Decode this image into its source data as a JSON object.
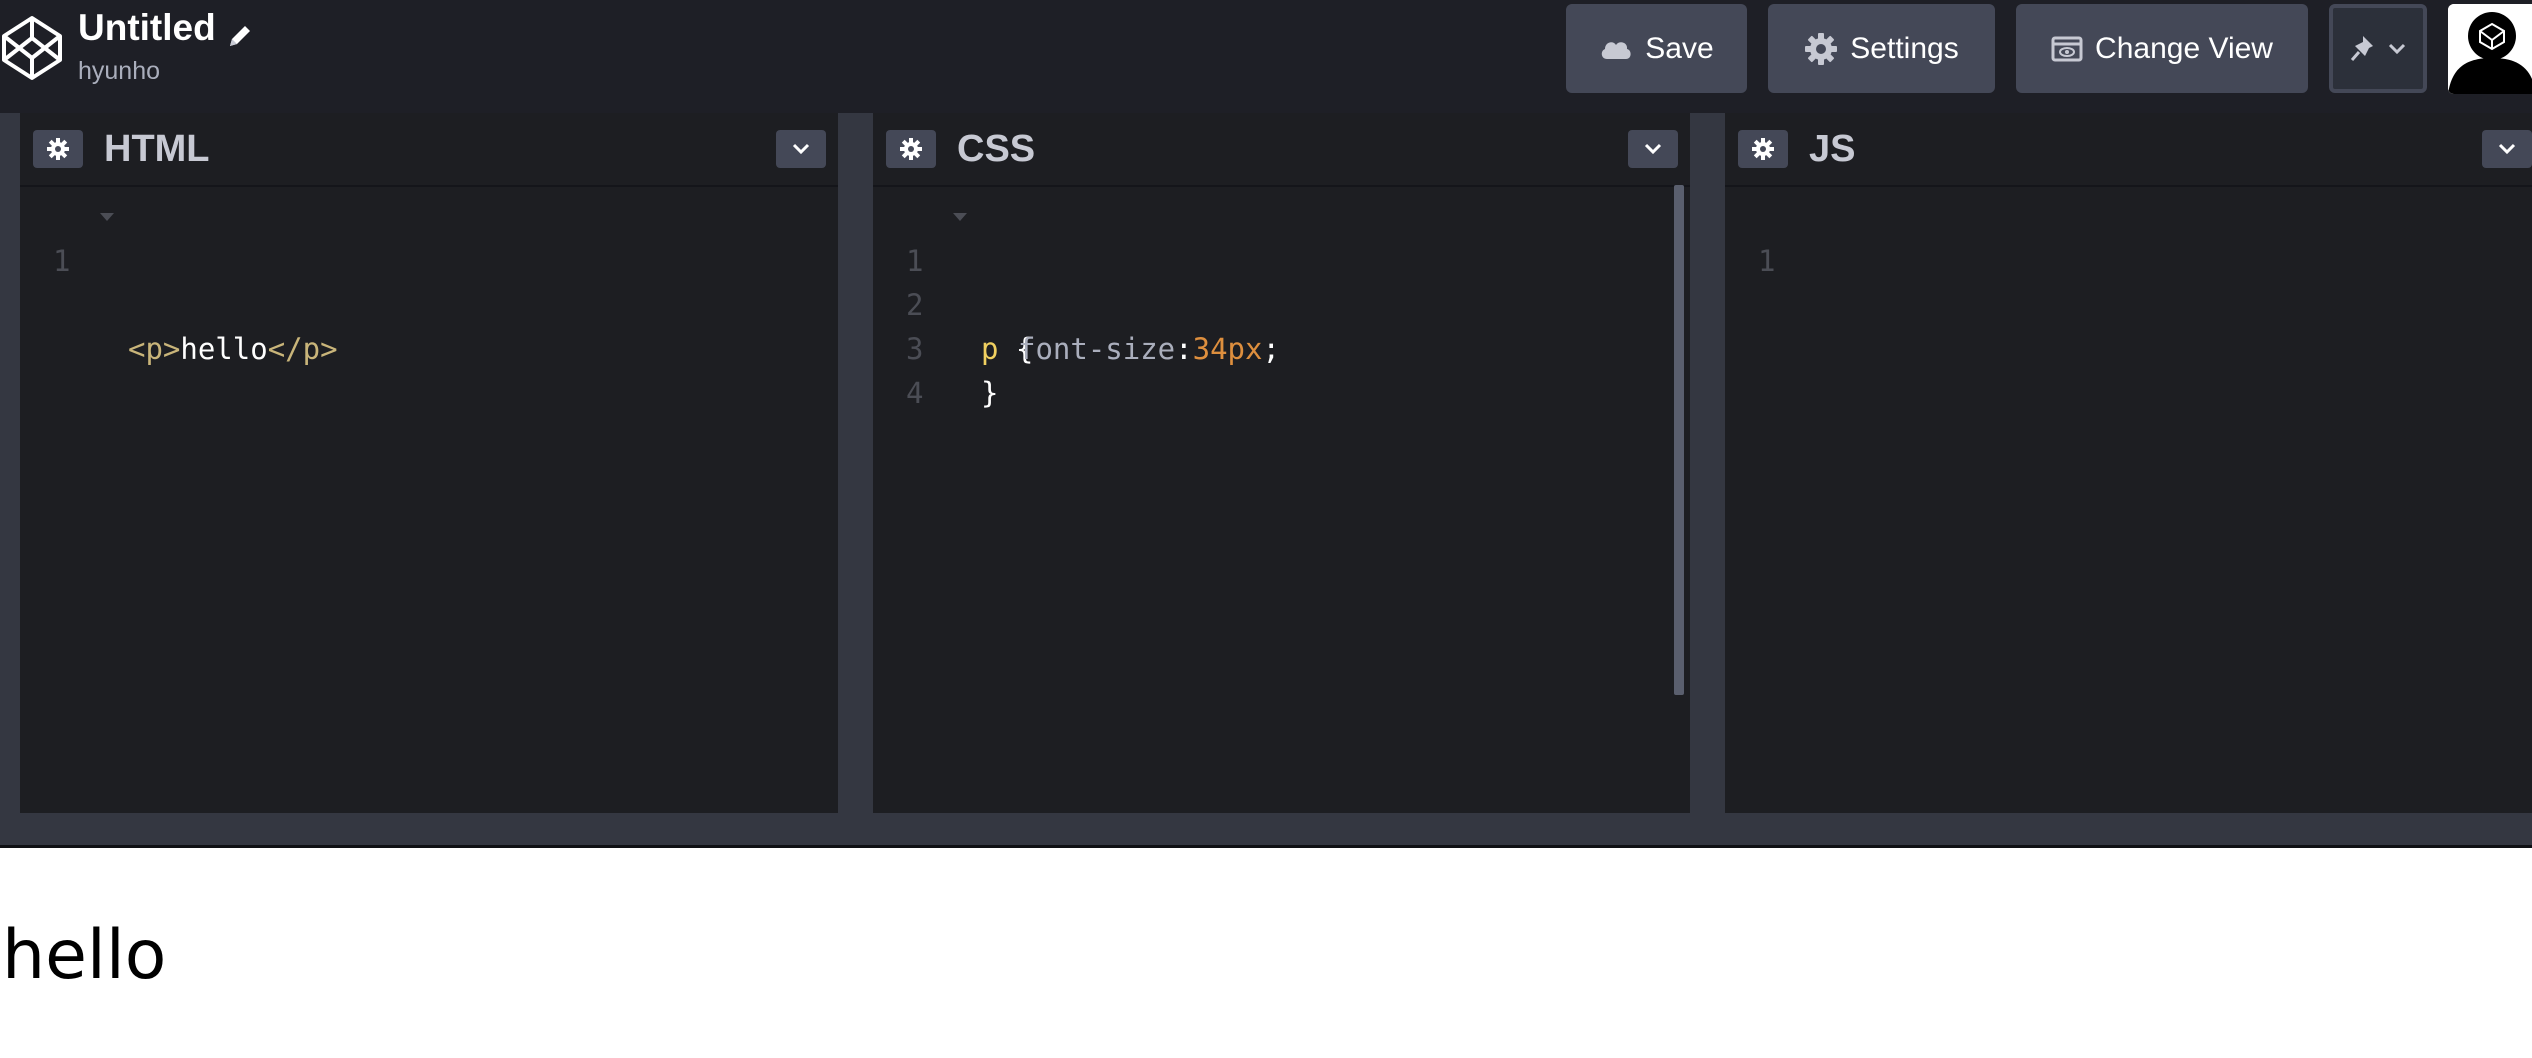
{
  "header": {
    "title": "Untitled",
    "user": "hyunho",
    "save_label": "Save",
    "settings_label": "Settings",
    "change_view_label": "Change View"
  },
  "panels": {
    "html": {
      "label": "HTML",
      "lines": [
        {
          "num": "1",
          "open": "<p>",
          "text": "hello",
          "close": "</p>"
        }
      ]
    },
    "css": {
      "label": "CSS",
      "lines": [
        {
          "num": "1",
          "selector": "p",
          "brace": " {"
        },
        {
          "num": "2",
          "prop": "font-size",
          "colon": ":",
          "value": "34px",
          "semi": ";"
        },
        {
          "num": "3",
          "text": "}"
        },
        {
          "num": "4"
        }
      ]
    },
    "js": {
      "label": "JS",
      "lines": [
        {
          "num": "1"
        }
      ]
    }
  },
  "preview": {
    "text": "hello"
  },
  "colors": {
    "header_bg": "#1e1f26",
    "editor_bg": "#1d1e22",
    "button_bg": "#444857",
    "tag": "#c9b57a",
    "selector": "#f0d060",
    "value": "#de8f3e"
  }
}
